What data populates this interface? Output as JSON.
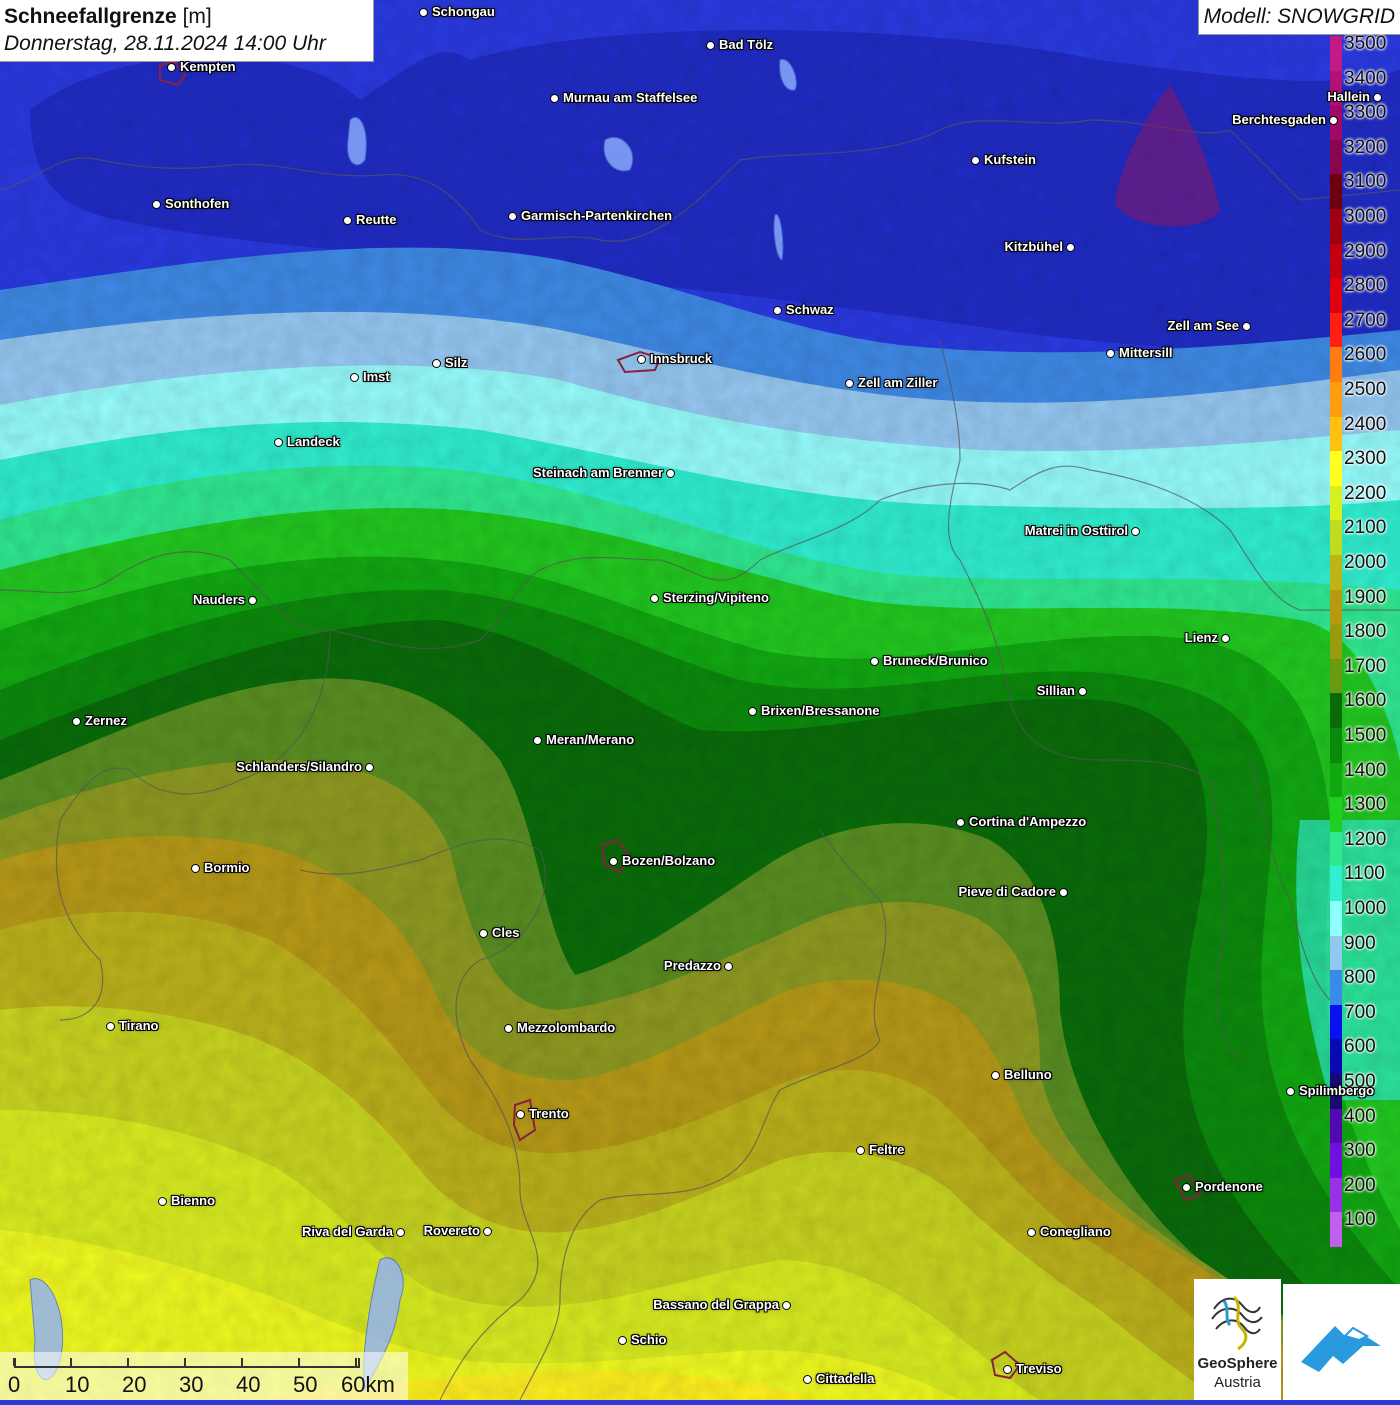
{
  "header": {
    "title_bold": "Schneefallgrenze",
    "title_unit": "[m]",
    "subtitle": "Donnerstag, 28.11.2024 14:00 Uhr",
    "model": "Modell: SNOWGRID"
  },
  "legend": {
    "entries": [
      {
        "label": "3500",
        "color": "#c21a87"
      },
      {
        "label": "3400",
        "color": "#b21276"
      },
      {
        "label": "3300",
        "color": "#a00a66"
      },
      {
        "label": "3200",
        "color": "#8a0550"
      },
      {
        "label": "3100",
        "color": "#6e0010"
      },
      {
        "label": "3000",
        "color": "#a00010"
      },
      {
        "label": "2900",
        "color": "#c40010"
      },
      {
        "label": "2800",
        "color": "#e00010"
      },
      {
        "label": "2700",
        "color": "#ff2010"
      },
      {
        "label": "2600",
        "color": "#ff7a10"
      },
      {
        "label": "2500",
        "color": "#ff9c10"
      },
      {
        "label": "2400",
        "color": "#ffc010"
      },
      {
        "label": "2300",
        "color": "#ffff20"
      },
      {
        "label": "2200",
        "color": "#d8f020"
      },
      {
        "label": "2100",
        "color": "#c0dc20"
      },
      {
        "label": "2000",
        "color": "#bcb418"
      },
      {
        "label": "1900",
        "color": "#b89a10"
      },
      {
        "label": "1800",
        "color": "#9a9a10"
      },
      {
        "label": "1700",
        "color": "#6a9a10"
      },
      {
        "label": "1600",
        "color": "#0a6a0a"
      },
      {
        "label": "1500",
        "color": "#0a8a0a"
      },
      {
        "label": "1400",
        "color": "#10a810"
      },
      {
        "label": "1300",
        "color": "#20d020"
      },
      {
        "label": "1200",
        "color": "#30e890"
      },
      {
        "label": "1100",
        "color": "#30f0d0"
      },
      {
        "label": "1000",
        "color": "#90ffff"
      },
      {
        "label": "900",
        "color": "#90c8f0"
      },
      {
        "label": "800",
        "color": "#3a8ae8"
      },
      {
        "label": "700",
        "color": "#0a10f0"
      },
      {
        "label": "600",
        "color": "#0a08b0"
      },
      {
        "label": "500",
        "color": "#180870"
      },
      {
        "label": "400",
        "color": "#5008b0"
      },
      {
        "label": "300",
        "color": "#7010e0"
      },
      {
        "label": "200",
        "color": "#9a30e8"
      },
      {
        "label": "100",
        "color": "#c060f0"
      }
    ]
  },
  "cities": [
    {
      "name": "Schongau",
      "side": "r"
    },
    {
      "name": "Bad Tölz",
      "side": "r"
    },
    {
      "name": "Kempten",
      "side": "r"
    },
    {
      "name": "Murnau am Staffelsee",
      "side": "r"
    },
    {
      "name": "Hallein",
      "side": "l"
    },
    {
      "name": "Berchtesgaden",
      "side": "l"
    },
    {
      "name": "Kufstein",
      "side": "r"
    },
    {
      "name": "Sonthofen",
      "side": "r"
    },
    {
      "name": "Reutte",
      "side": "r"
    },
    {
      "name": "Garmisch-Partenkirchen",
      "side": "r"
    },
    {
      "name": "Kitzbühel",
      "side": "l"
    },
    {
      "name": "Schwaz",
      "side": "r"
    },
    {
      "name": "Zell am See",
      "side": "l"
    },
    {
      "name": "Innsbruck",
      "side": "r"
    },
    {
      "name": "Mittersill",
      "side": "r"
    },
    {
      "name": "Silz",
      "side": "r"
    },
    {
      "name": "Imst",
      "side": "r"
    },
    {
      "name": "Zell am Ziller",
      "side": "r"
    },
    {
      "name": "Landeck",
      "side": "r"
    },
    {
      "name": "Steinach am Brenner",
      "side": "l"
    },
    {
      "name": "Matrei in Osttirol",
      "side": "l"
    },
    {
      "name": "Nauders",
      "side": "l"
    },
    {
      "name": "Sterzing/Vipiteno",
      "side": "r"
    },
    {
      "name": "Lienz",
      "side": "l"
    },
    {
      "name": "Bruneck/Brunico",
      "side": "r"
    },
    {
      "name": "Sillian",
      "side": "l"
    },
    {
      "name": "Zernez",
      "side": "r"
    },
    {
      "name": "Brixen/Bressanone",
      "side": "r"
    },
    {
      "name": "Meran/Merano",
      "side": "r"
    },
    {
      "name": "Schlanders/Silandro",
      "side": "l"
    },
    {
      "name": "Cortina d'Ampezzo",
      "side": "r"
    },
    {
      "name": "Bozen/Bolzano",
      "side": "r"
    },
    {
      "name": "Bormio",
      "side": "r"
    },
    {
      "name": "Pieve di Cadore",
      "side": "l"
    },
    {
      "name": "Cles",
      "side": "r"
    },
    {
      "name": "Predazzo",
      "side": "l"
    },
    {
      "name": "Tirano",
      "side": "r"
    },
    {
      "name": "Mezzolombardo",
      "side": "r"
    },
    {
      "name": "Belluno",
      "side": "r"
    },
    {
      "name": "Spilimbergo",
      "side": "r"
    },
    {
      "name": "Trento",
      "side": "r"
    },
    {
      "name": "Feltre",
      "side": "r"
    },
    {
      "name": "Pordenone",
      "side": "r"
    },
    {
      "name": "Bienno",
      "side": "r"
    },
    {
      "name": "Riva del Garda",
      "side": "l"
    },
    {
      "name": "Rovereto",
      "side": "l"
    },
    {
      "name": "Conegliano",
      "side": "r"
    },
    {
      "name": "Bassano del Grappa",
      "side": "l"
    },
    {
      "name": "Schio",
      "side": "r"
    },
    {
      "name": "Treviso",
      "side": "r"
    },
    {
      "name": "Cittadella",
      "side": "r"
    }
  ],
  "scale": {
    "labels": [
      "0",
      "10",
      "20",
      "30",
      "40",
      "50",
      "60km"
    ]
  },
  "logos": {
    "geosphere_line1": "GeoSphere",
    "geosphere_line2": "Austria"
  }
}
